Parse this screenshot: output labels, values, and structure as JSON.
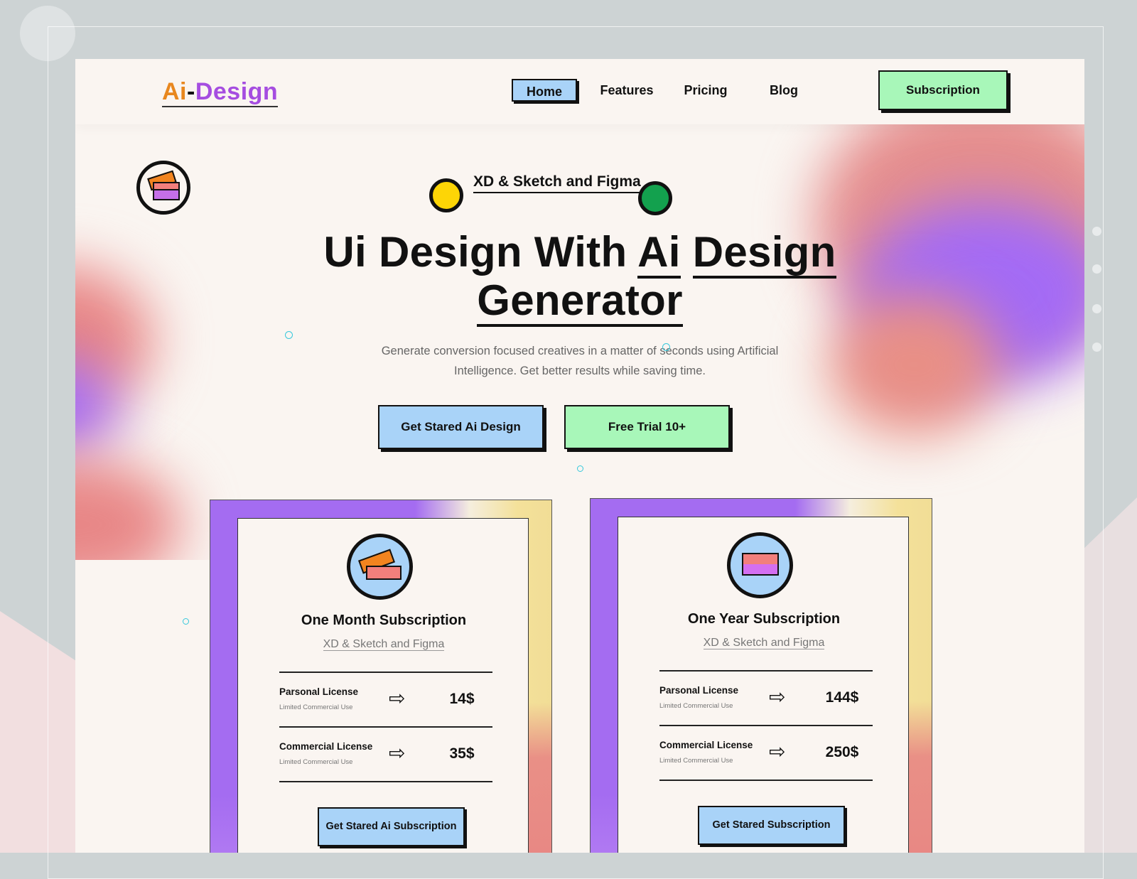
{
  "logo": {
    "part1": "Ai",
    "dash": "-",
    "part2": "Design"
  },
  "nav": {
    "items": [
      {
        "label": "Home",
        "active": true
      },
      {
        "label": "Features",
        "active": false
      },
      {
        "label": "Pricing",
        "active": false
      },
      {
        "label": "Blog",
        "active": false
      }
    ],
    "cta_label": "Subscription"
  },
  "hero": {
    "tag": "XD & Sketch and Figma",
    "title_line1_a": "Ui Design With",
    "title_line1_b": "Ai",
    "title_line1_c": "Design",
    "title_line2": "Generator",
    "description": "Generate conversion focused creatives in a matter of seconds using Artificial Intelligence. Get better results while saving time.",
    "primary_cta": "Get Stared Ai Design",
    "secondary_cta": "Free Trial 10+"
  },
  "plans": [
    {
      "icon": "tickets-icon",
      "title": "One Month Subscription",
      "subtitle": "XD & Sketch and Figma",
      "licenses": [
        {
          "name": "Parsonal License",
          "note": "Limited Commercial Use",
          "price": "14$"
        },
        {
          "name": "Commercial License",
          "note": "Limited Commercial Use",
          "price": "35$"
        }
      ],
      "button": "Get Stared Ai Subscription"
    },
    {
      "icon": "stacked-cards-icon",
      "title": "One Year Subscription",
      "subtitle": "XD & Sketch and Figma",
      "licenses": [
        {
          "name": "Parsonal License",
          "note": "Limited Commercial Use",
          "price": "144$"
        },
        {
          "name": "Commercial License",
          "note": "Limited Commercial Use",
          "price": "250$"
        }
      ],
      "button": "Get Stared Subscription"
    }
  ],
  "colors": {
    "accent_blue": "#a9d3f8",
    "accent_green": "#a8f7b9",
    "purple": "#a46cf1",
    "coral": "#e88787",
    "yellow": "#fdd506",
    "green_dot": "#13a14e"
  }
}
